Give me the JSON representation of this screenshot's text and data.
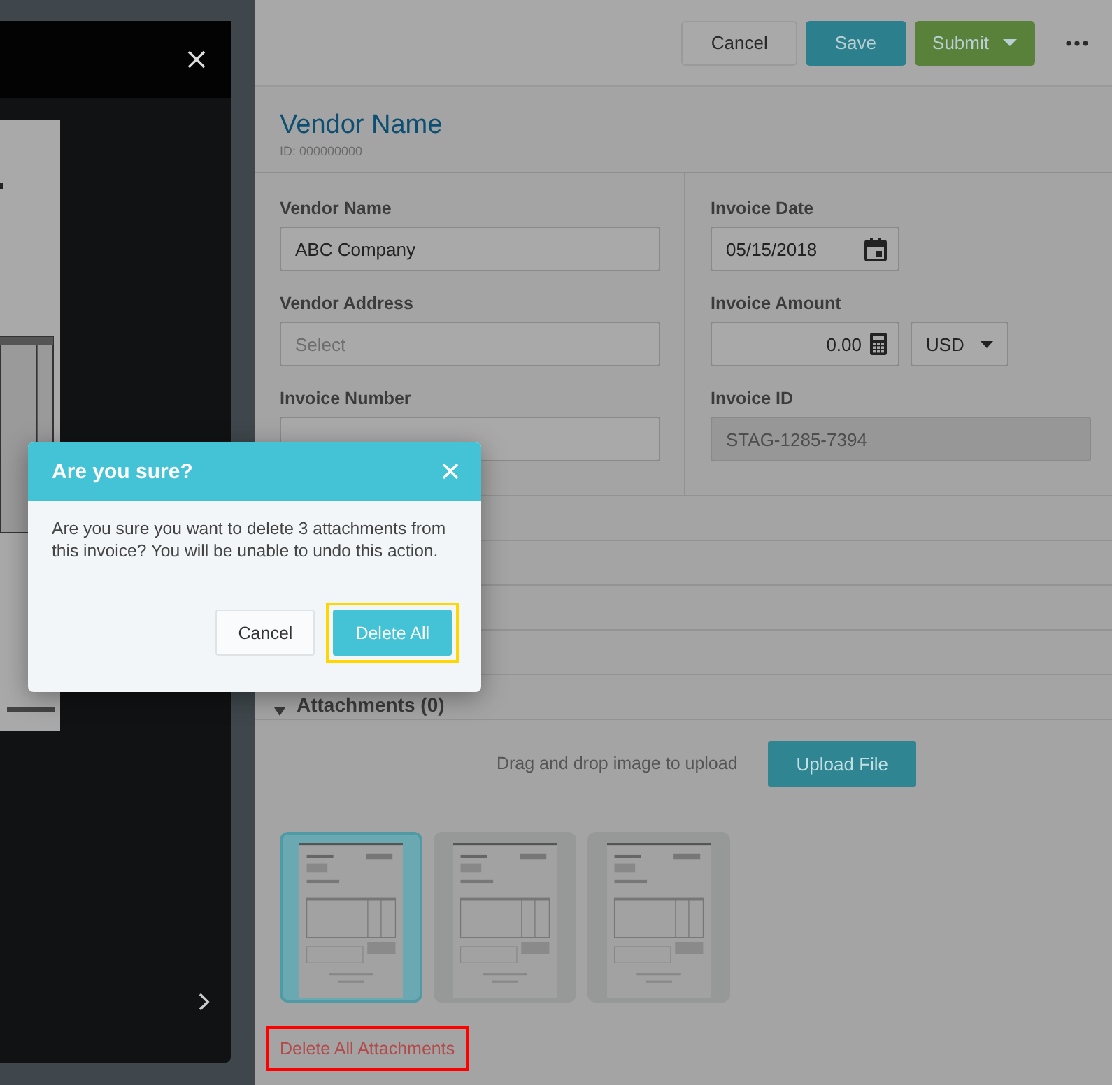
{
  "toolbar": {
    "buttons": [
      {
        "label": "Cancel",
        "kind": "plain"
      },
      {
        "label": "Save",
        "kind": "primary"
      },
      {
        "label": "Submit",
        "kind": "split"
      }
    ]
  },
  "vendor": {
    "title": "Vendor Name",
    "id": "ID: 000000000"
  },
  "form": {
    "left": [
      {
        "label": "Vendor Name",
        "value": "ABC Company",
        "kind": "text"
      },
      {
        "label": "Vendor Address",
        "placeholder": "Select",
        "kind": "text"
      },
      {
        "label": "Invoice Number",
        "kind": "text"
      }
    ],
    "right": [
      {
        "label": "Invoice Date",
        "value": "05/15/2018",
        "kind": "date"
      },
      {
        "label": "Invoice Amount",
        "value": "0.00",
        "currency": "USD",
        "kind": "amount"
      },
      {
        "label": "Invoice ID",
        "value": "STAG-1285-7394",
        "kind": "readonly"
      }
    ]
  },
  "attachments": {
    "title": "Attachments (0)",
    "expanded": true,
    "hint": "Drag and drop image to upload",
    "upload": "Upload File",
    "thumbnails": [
      {
        "selected": true
      },
      {
        "selected": false
      },
      {
        "selected": false
      }
    ],
    "delete_link": {
      "label": "Delete All Attachments",
      "highlighted": true
    }
  },
  "dialog": {
    "title": "Are you sure?",
    "message": "Are you sure you want to delete 3 attachments from this invoice? You will be unable to undo this action.",
    "buttons": [
      {
        "label": "Cancel",
        "kind": "secondary",
        "highlighted": false
      },
      {
        "label": "Delete All",
        "kind": "primary",
        "highlighted": true
      }
    ]
  }
}
